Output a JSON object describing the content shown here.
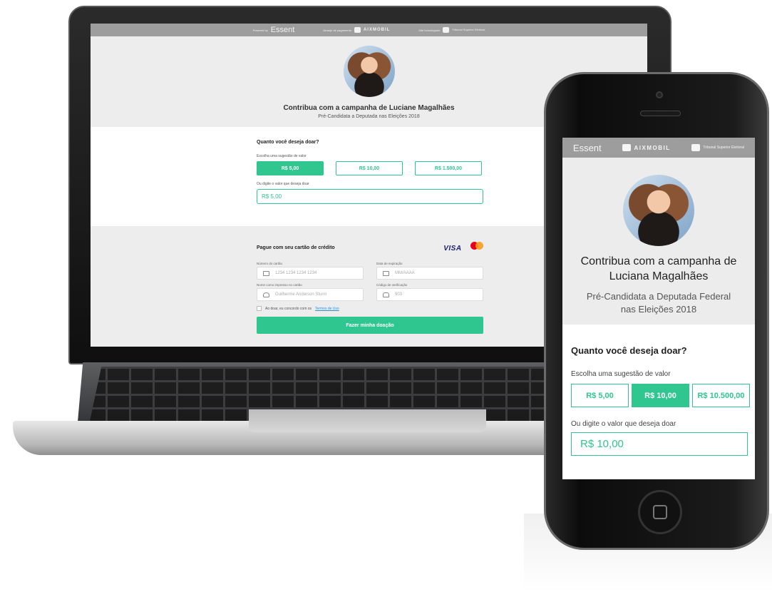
{
  "laptop": {
    "topbar": {
      "powered_by": "Powered by",
      "brand": "Essent",
      "payment_label": "Arranjo de pagamento",
      "aix": "AIXMOBIL",
      "homolog_label": "Site homologado",
      "tse": "Tribunal Superior Eleitoral"
    },
    "hero": {
      "title": "Contribua com a campanha de Luciane Magalhães",
      "subtitle": "Pré-Candidata a Deputada nas Eleições 2018"
    },
    "amount": {
      "heading": "Quanto você deseja doar?",
      "suggest_label": "Escolha uma sugestão de valor",
      "options": [
        "R$ 5,00",
        "R$ 10,00",
        "R$ 1.500,00"
      ],
      "custom_label": "Ou digite o valor que deseja doar",
      "custom_value": "R$ 5,00"
    },
    "payment": {
      "heading": "Pague com seu cartão de crédito",
      "visa": "VISA",
      "card_number_label": "Número do cartão",
      "card_number_placeholder": "1234 1234 1234 1234",
      "expiry_label": "Data de expiração",
      "expiry_placeholder": "MM/AAAA",
      "name_label": "Nome como impresso no cartão",
      "name_placeholder": "Guilherme Anderson Sturm",
      "cvv_label": "Código de verificação",
      "cvv_placeholder": "903",
      "terms_prefix": "Ao doar, eu concordo com os",
      "terms_link": "Termos de Uso",
      "submit": "Fazer minha doação"
    }
  },
  "phone": {
    "topbar": {
      "brand": "Essent",
      "aix": "AIXMOBIL",
      "tse": "Tribunal Superior Eleitoral"
    },
    "hero": {
      "title_line1": "Contribua com a campanha de",
      "title_line2": "Luciana Magalhães",
      "subtitle_line1": "Pré-Candidata a Deputada Federal",
      "subtitle_line2": "nas Eleições 2018"
    },
    "amount": {
      "heading": "Quanto você deseja doar?",
      "suggest_label": "Escolha uma sugestão de valor",
      "options": [
        "R$ 5,00",
        "R$ 10,00",
        "R$ 10.500,00"
      ],
      "custom_label": "Ou digite o valor que deseja doar",
      "custom_value": "R$ 10,00"
    }
  },
  "colors": {
    "accent": "#2fc690",
    "topbar": "#9d9d9d",
    "link": "#2a8fd6"
  }
}
